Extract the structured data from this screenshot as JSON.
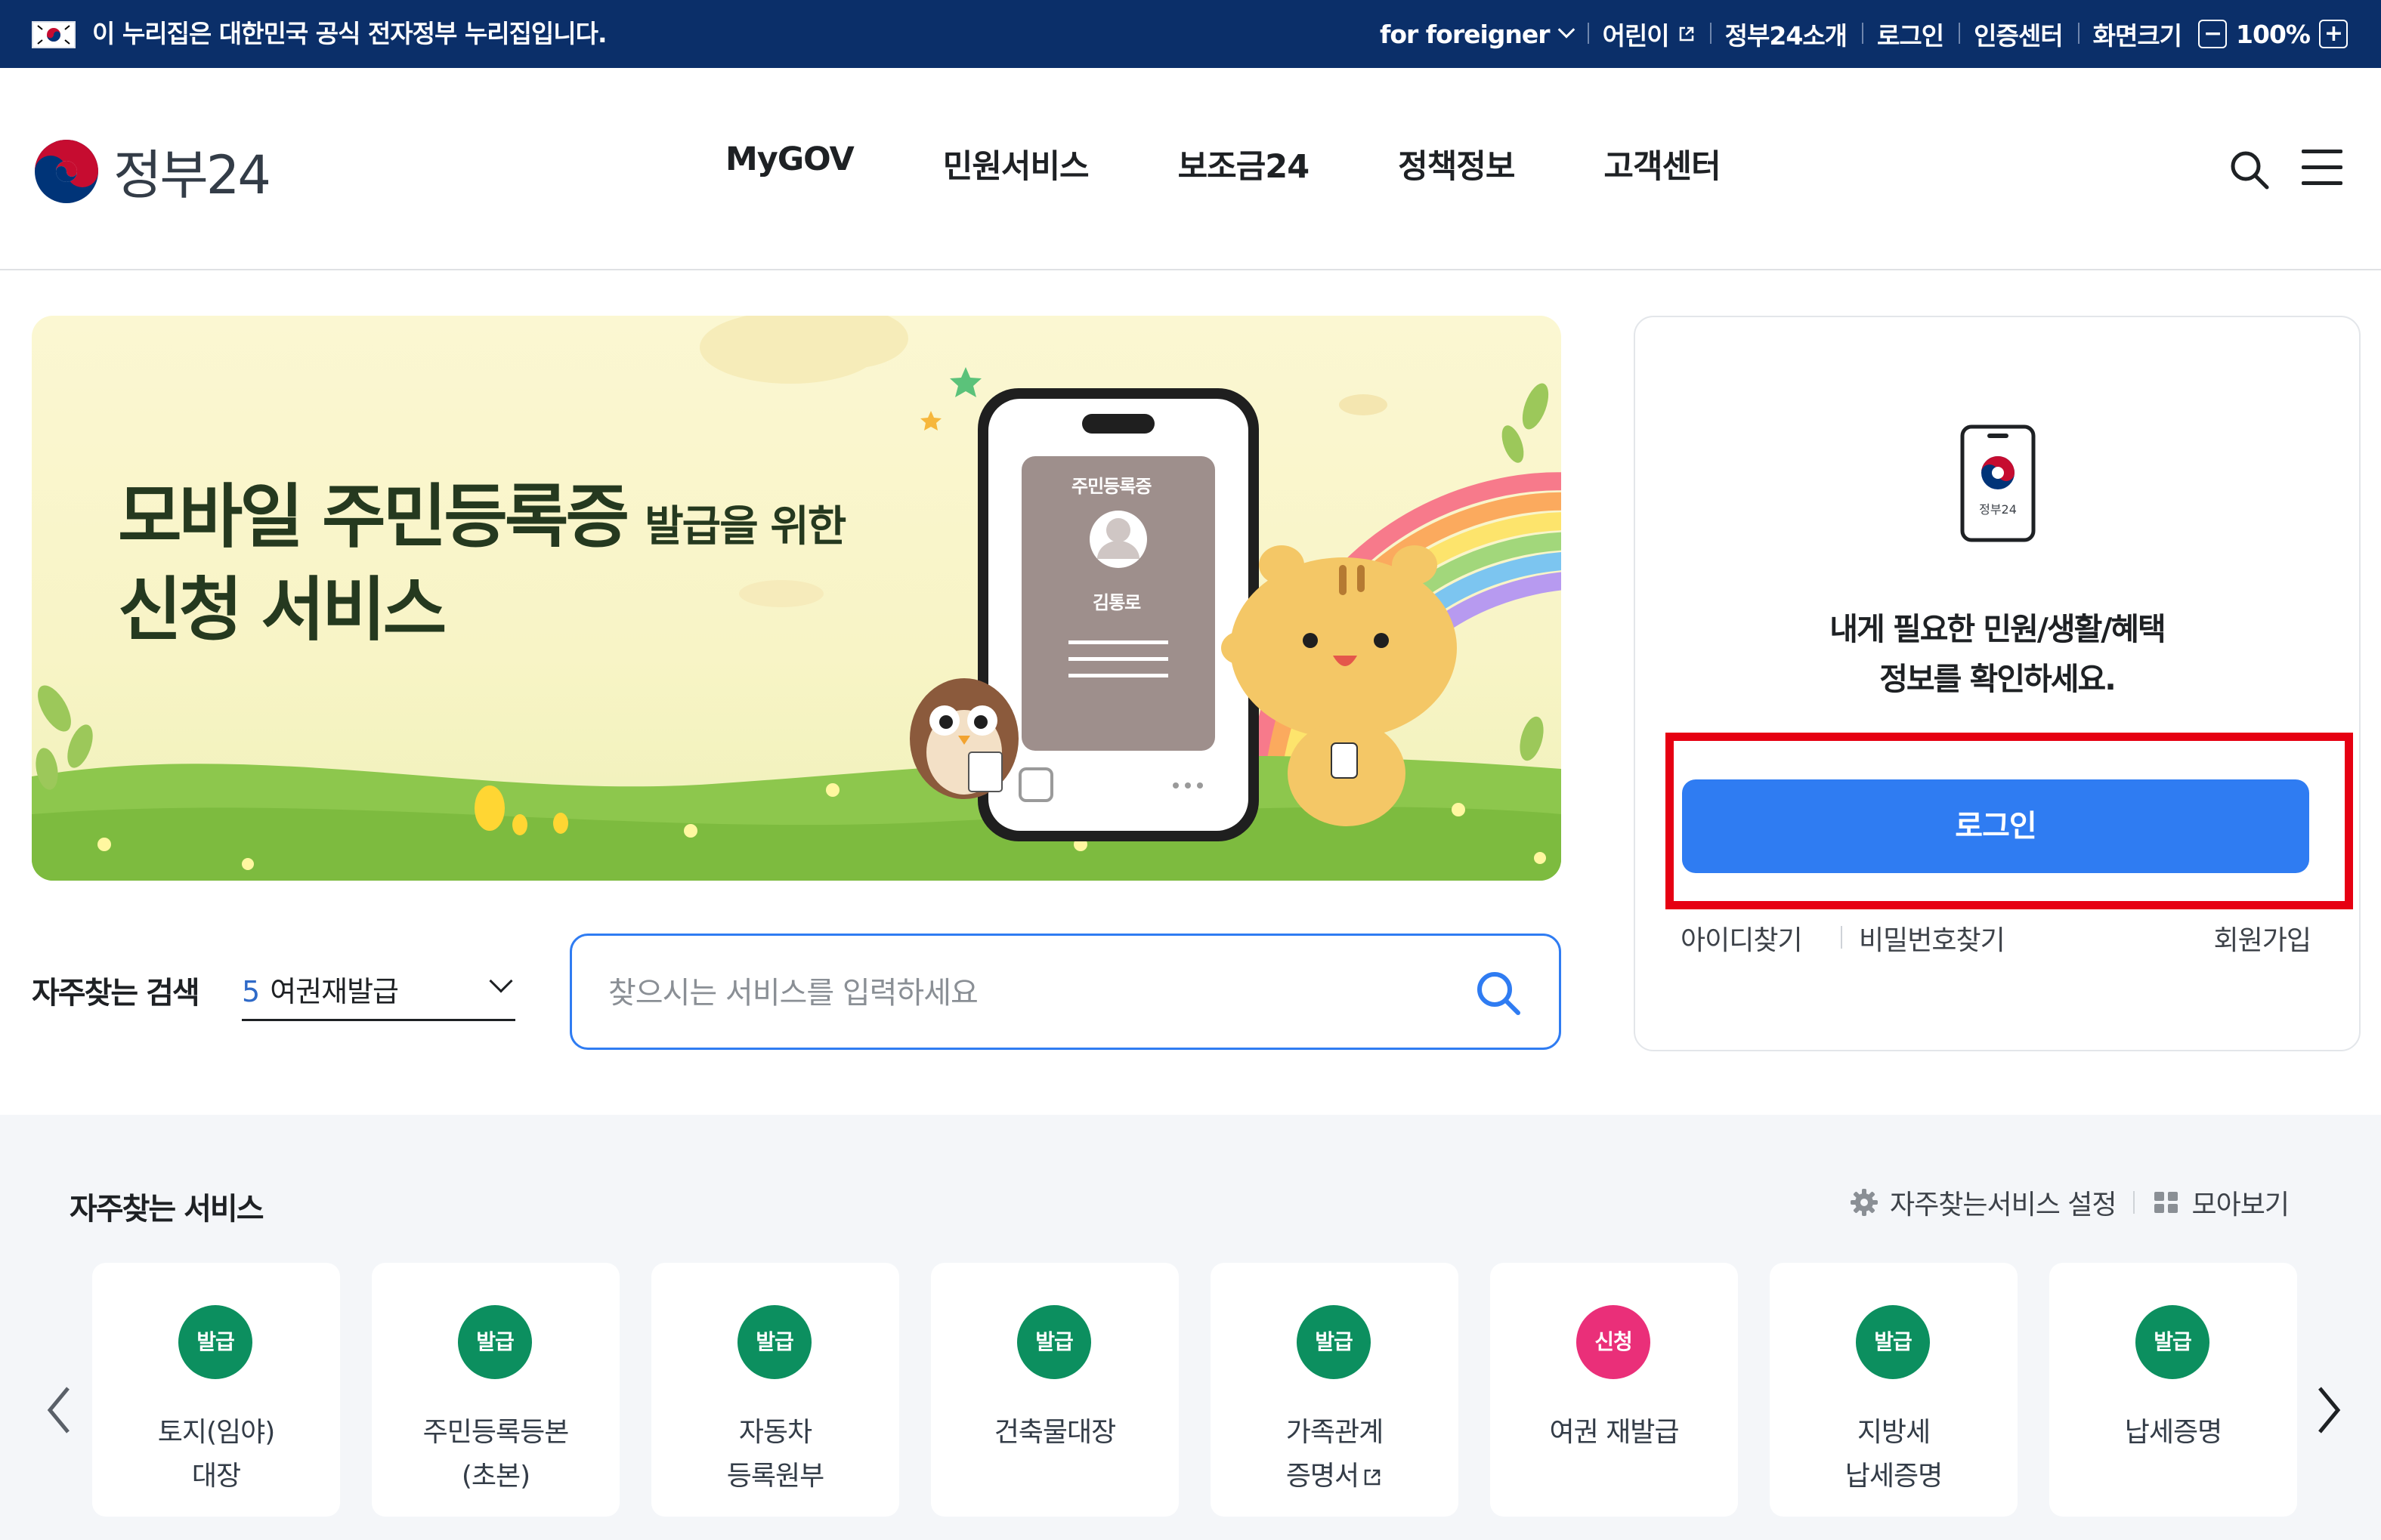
{
  "gov_banner": {
    "notice": "이 누리집은 대한민국 공식 전자정부 누리집입니다.",
    "links": [
      "for foreigner",
      "어린이",
      "정부24소개",
      "로그인",
      "인증센터",
      "화면크기"
    ],
    "zoom_minus": "−",
    "zoom_value": "100%",
    "zoom_plus": "+",
    "bg_color": "#0b2f69"
  },
  "header": {
    "logo_text": "정부24",
    "nav": [
      "MyGOV",
      "민원서비스",
      "보조금24",
      "정책정보",
      "고객센터"
    ],
    "icons": [
      "search-icon",
      "hamburger-menu-icon"
    ]
  },
  "hero": {
    "title_main": "모바일 주민등록증",
    "title_small": "발급을 위한",
    "title_line2": "신청 서비스",
    "phone_card_title": "주민등록증",
    "phone_card_name": "김통로"
  },
  "login_card": {
    "device_label": "정부24",
    "message_line1": "내게 필요한 민원/생활/혜택",
    "message_line2": "정보를 확인하세요.",
    "login_button": "로그인",
    "find_id": "아이디찾기",
    "find_password": "비밀번호찾기",
    "signup": "회원가입",
    "accent_color": "#2f7cf2",
    "highlight_color": "#e60012"
  },
  "search": {
    "frequent_label": "자주찾는 검색",
    "rank": "5",
    "selected_keyword": "여권재발급",
    "placeholder": "찾으시는 서비스를 입력하세요"
  },
  "services": {
    "title": "자주찾는 서비스",
    "settings_label": "자주찾는서비스 설정",
    "view_all_label": "모아보기",
    "items": [
      {
        "badge": "발급",
        "line1": "토지(임야)",
        "line2": "대장",
        "badge_color": "green"
      },
      {
        "badge": "발급",
        "line1": "주민등록등본",
        "line2": "(초본)",
        "badge_color": "green"
      },
      {
        "badge": "발급",
        "line1": "자동차",
        "line2": "등록원부",
        "badge_color": "green"
      },
      {
        "badge": "발급",
        "line1": "건축물대장",
        "line2": "",
        "badge_color": "green"
      },
      {
        "badge": "발급",
        "line1": "가족관계",
        "line2": "증명서",
        "badge_color": "green"
      },
      {
        "badge": "신청",
        "line1": "여권 재발급",
        "line2": "",
        "badge_color": "pink"
      },
      {
        "badge": "발급",
        "line1": "지방세",
        "line2": "납세증명",
        "badge_color": "green"
      },
      {
        "badge": "발급",
        "line1": "납세증명",
        "line2": "",
        "badge_color": "green"
      }
    ]
  }
}
